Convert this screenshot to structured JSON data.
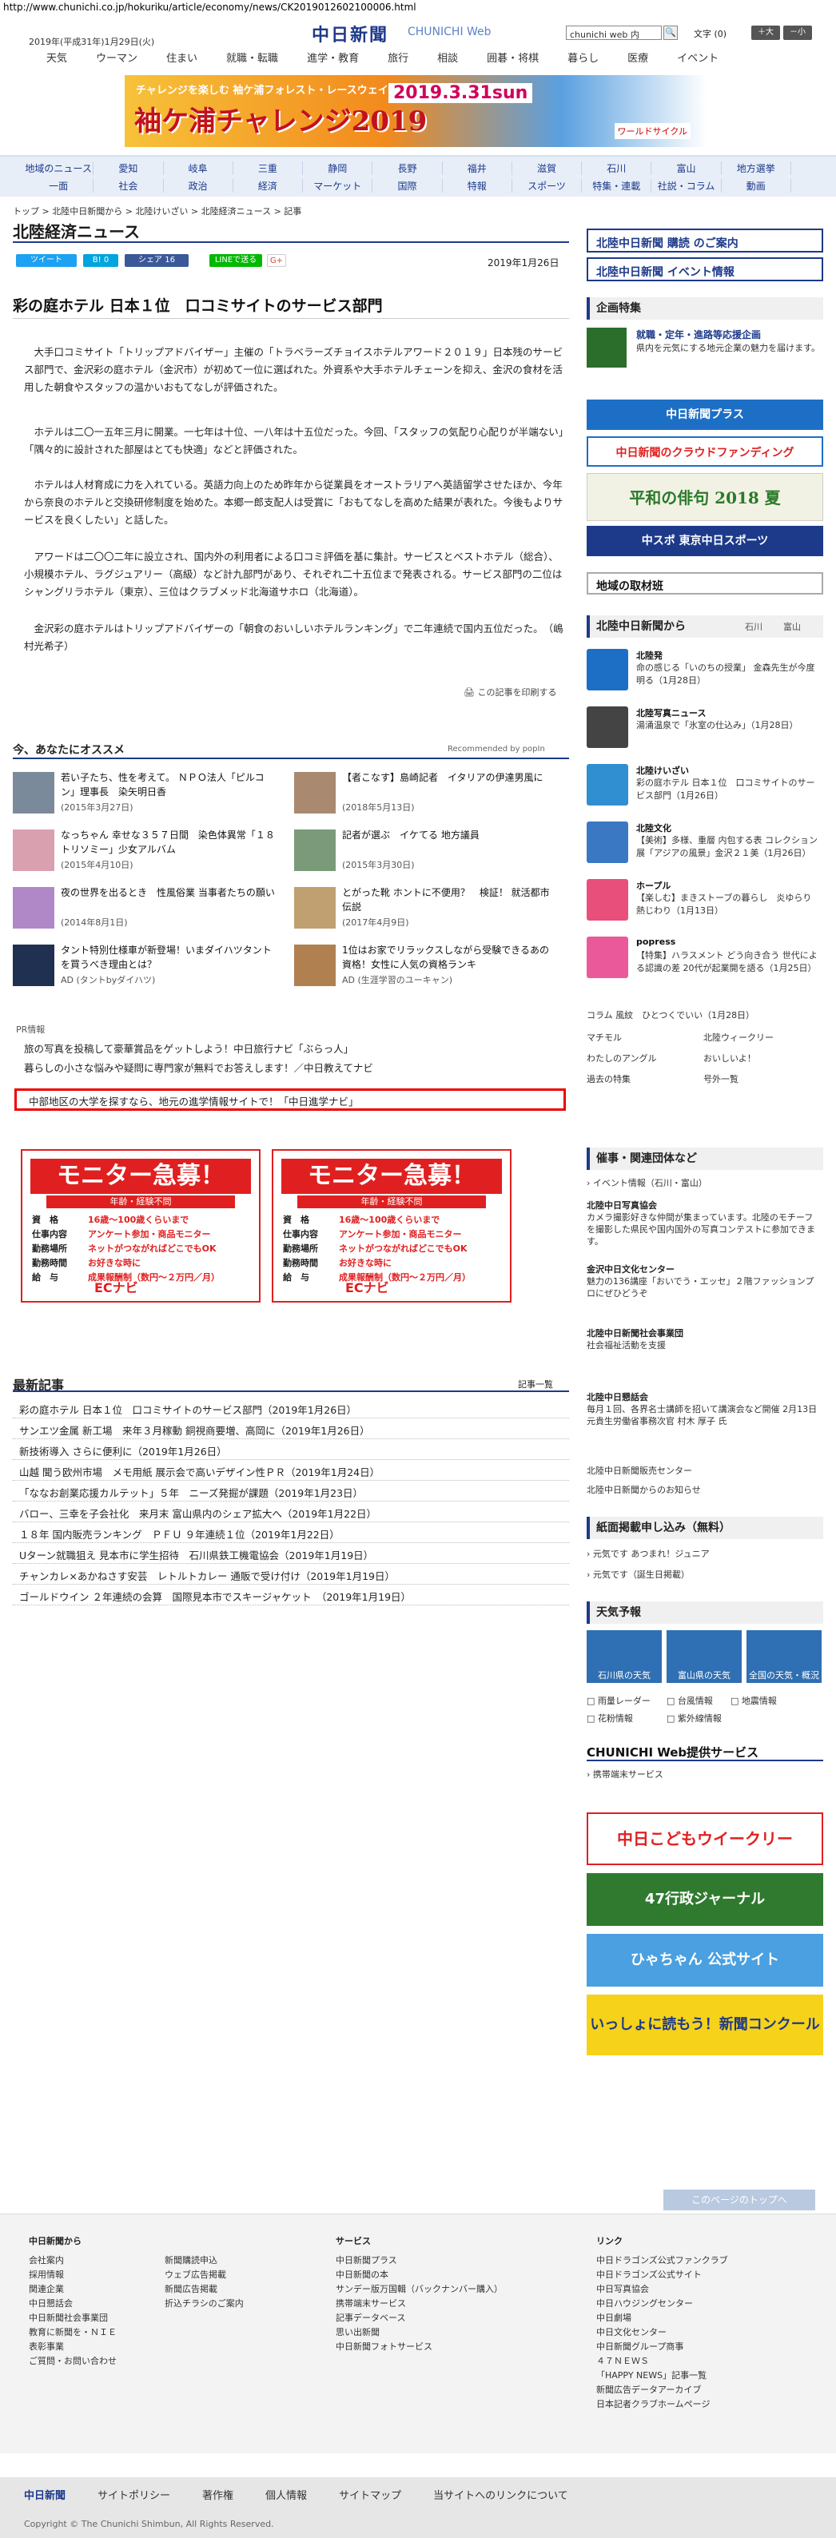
{
  "url": "http://www.chunichi.co.jp/hokuriku/article/economy/news/CK2019012602100006.html",
  "header": {
    "date": "2019年(平成31年)1月29日(火)",
    "logo": "中日新聞",
    "logo_sub": "CHUNICHI Web",
    "search_placeholder": "chunichi web 内",
    "search_button": "🔍",
    "font_label": "文字",
    "font_reset": "(0)",
    "font_up": "＋大",
    "font_down": "－小"
  },
  "top_nav": [
    "天気",
    "ウーマン",
    "住まい",
    "就職・転職",
    "進学・教育",
    "旅行",
    "相談",
    "囲碁・将棋",
    "暮らし",
    "医療",
    "イベント"
  ],
  "ad_banner": {
    "line1": "チャレンジを楽しむ 袖ケ浦フォレスト・レースウェイ",
    "line2": "袖ケ浦チャレンジ2019",
    "line3": "2019.3.31sun",
    "line4": "ワールドサイクル"
  },
  "region_nav_row1": [
    "地域のニュース",
    "愛知",
    "岐阜",
    "三重",
    "静岡",
    "長野",
    "福井",
    "滋賀",
    "石川",
    "富山",
    "地方選挙"
  ],
  "region_nav_row2": [
    "一面",
    "社会",
    "政治",
    "経済",
    "マーケット",
    "国際",
    "特報",
    "スポーツ",
    "特集・連載",
    "社説・コラム",
    "動画"
  ],
  "breadcrumb": "トップ > 北陸中日新聞から > 北陸けいざい > 北陸経済ニュース > 記事",
  "section_title": "北陸経済ニュース",
  "share": {
    "tweet": "ツイート",
    "b": "B! 0",
    "fb": "シェア 16",
    "line": "LINEで送る",
    "g": "G+"
  },
  "pubdate": "2019年1月26日",
  "article": {
    "headline": "彩の庭ホテル 日本１位　口コミサイトのサービス部門",
    "paragraphs": [
      "　大手口コミサイト「トリップアドバイザー」主催の「トラベラーズチョイスホテルアワード２０１９」日本残のサービス部門で、金沢彩の庭ホテル（金沢市）が初めて一位に選ばれた。外資系や大手ホテルチェーンを抑え、金沢の食材を活用した朝食やスタッフの温かいおもてなしが評価された。",
      "　ホテルは二〇一五年三月に開業。一七年は十位、一八年は十五位だった。今回、「スタッフの気配り心配りが半端ない」「隅々的に設計された部屋はとても快適」などと評価された。",
      "　ホテルは人材育成に力を入れている。英語力向上のため昨年から従業員をオーストラリアへ英語留学させたほか、今年から奈良のホテルと交換研修制度を始めた。本郷一郎支配人は受賞に「おもてなしを高めた結果が表れた。今後もよりサービスを良くしたい」と話した。",
      "　アワードは二〇〇二年に設立され、国内外の利用者による口コミ評価を基に集計。サービスとベストホテル（総合）、小規模ホテル、ラグジュアリー（高級）など計九部門があり、それぞれ二十五位まで発表される。サービス部門の二位はシャングリラホテル（東京）、三位はクラブメッド北海道サホロ（北海道）。",
      "　金沢彩の庭ホテルはトリップアドバイザーの「朝食のおいしいホテルランキング」で二年連続で国内五位だった。　（嶋村光希子）"
    ],
    "print": "この記事を印刷する"
  },
  "recommend": {
    "title": "今、あなたにオススメ",
    "powered": "Recommended by popIn",
    "items": [
      {
        "text": "若い子たち、性を考えて。 ＮＰＯ法人「ピルコン」理事長　染矢明日香",
        "date": "(2015年3月27日)"
      },
      {
        "text": "【者こなす】島崎記者　イタリアの伊達男風に",
        "date": "(2018年5月13日)"
      },
      {
        "text": "なっちゃん 幸せな３５７日間　染色体異常「１８トリソミー」少女アルバム",
        "date": "(2015年4月10日)"
      },
      {
        "text": "記者が選ぶ　イケてる 地方議員",
        "date": "(2015年3月30日)"
      },
      {
        "text": "夜の世界を出るとき　性風俗業 当事者たちの願い",
        "date": "(2014年8月1日)"
      },
      {
        "text": "とがった靴 ホントに不便用？　検証！ 就活都市伝説",
        "date": "(2017年4月9日)"
      },
      {
        "text": "タント特別仕様車が新登場！いまダイハツタントを買うべき理由とは？",
        "date": "AD (タントbyダイハツ)"
      },
      {
        "text": "1位はお家でリラックスしながら受験できるあの資格！女性に人気の資格ランキ",
        "date": "AD (生涯学習のユーキャン)"
      }
    ]
  },
  "pr": {
    "label": "PR情報",
    "items": [
      "旅の写真を投稿して豪華賞品をゲットしよう！中日旅行ナビ「ぶらっ人」",
      "暮らしの小さな悩みや疑問に専門家が無料でお答えします！／中日教えてナビ",
      "中部地区の大学を探すなら、地元の進学情報サイトで！「中日進学ナビ」"
    ]
  },
  "monitor": {
    "title": "モニター急募！",
    "sub": "年齢・経験不問",
    "rows": [
      {
        "k": "資　格",
        "v": "16歳～100歳くらいまで"
      },
      {
        "k": "仕事内容",
        "v": "アンケート参加・商品モニター"
      },
      {
        "k": "勤務場所",
        "v": "ネットがつながればどこでもOK"
      },
      {
        "k": "勤務時間",
        "v": "お好きな時に"
      },
      {
        "k": "給　与",
        "v": "成果報酬制（数円～２万円／月）"
      }
    ],
    "logo": "ECナビ"
  },
  "latest": {
    "title": "最新記事",
    "more": "記事一覧",
    "items": [
      "彩の庭ホテル 日本１位　口コミサイトのサービス部門（2019年1月26日）",
      "サンエツ金属 新工場　来年３月稼動 銅視商要増、高岡に（2019年1月26日）",
      "新技術導入 さらに便利に（2019年1月26日）",
      "山越 聞う欧州市場　メモ用紙 展示会で高いデザイン性ＰＲ（2019年1月24日）",
      "「ななお創業応援カルテット」５年　ニーズ発掘が課題（2019年1月23日）",
      "バロー、三幸を子会社化　来月末 富山県内のシェア拡大へ（2019年1月22日）",
      "１８年 国内販売ランキング　ＰＦＵ ９年連続１位（2019年1月22日）",
      "Uターン就職狙え 見本市に学生招待　石川県鉄工機電協会（2019年1月19日）",
      "チャンカレ×あかねさす安芸　レトルトカレー 通販で受け付け（2019年1月19日）",
      "ゴールドウイン ２年連続の会算　国際見本市でスキージャケット　（2019年1月19日）"
    ]
  },
  "side": {
    "subscribe": "北陸中日新聞 購読 のご案内",
    "event": "北陸中日新聞 イベント情報",
    "kikaku_title": "企画特集",
    "kikaku_text": "就職・定年・進路等応援企画",
    "kikaku_sub": "県内を元気にする地元企業の魅力を届けます。",
    "promos": [
      "中日新聞プラス",
      "中日新聞のクラウドファンディング",
      "平和の俳句 2018 夏",
      "中スポ 東京中日スポーツ"
    ],
    "local_info": "地域の取材班",
    "hokuriku_title": "北陸中日新聞から",
    "hokuriku_tabs": [
      "石川",
      "富山"
    ],
    "news": [
      {
        "cat": "北陸発",
        "text": "命の感じる「いのちの授業」 金森先生が今度明る（1月28日）"
      },
      {
        "cat": "北陸写真ニュース",
        "text": "湯涌温泉で「氷室の仕込み」（1月28日）"
      },
      {
        "cat": "北陸けいざい",
        "text": "彩の庭ホテル 日本１位　口コミサイトのサービス部門（1月26日）"
      },
      {
        "cat": "北陸文化",
        "text": "【美術】多様、重層 内包する表 コレクション展「アジアの風景」金沢２１美（1月26日）"
      },
      {
        "cat": "ホープル",
        "text": "【楽しむ】まきストーブの暮らし　炎ゆらり 熱じわり（1月13日）"
      },
      {
        "cat": "popress",
        "text": "【特集】ハラスメント どう向き合う 世代による認識の差 20代が起業開を語る（1月25日）"
      }
    ],
    "links": [
      "コラム 風紋　ひとつくでいい（1月28日）",
      "マチモル",
      "北陸ウィークリー",
      "わたしのアングル",
      "おいしいよ！",
      "過去の特集",
      "号外一覧"
    ],
    "event_title": "催事・関連団体など",
    "event_sub": "イベント情報（石川・富山）",
    "events": [
      {
        "cat": "北陸中日写真協会",
        "text": "カメラ撮影好きな仲間が集まっています。北陸のモチーフを撮影した県民や国内国外の写真コンテストに参加できます。"
      },
      {
        "cat": "金沢中日文化センター",
        "text": "魅力の136講座「おいでう・エッセ」２階ファッションプロにぜひどうぞ"
      },
      {
        "cat": "北陸中日新聞社会事業団",
        "text": "社会福祉活動を支援"
      },
      {
        "cat": "北陸中日懇話会",
        "text": "毎月１回、各界名士講師を招いて講演会など開催 2月13日 元貴生労働省事務次官 村木 厚子 氏"
      }
    ],
    "event_links": [
      "北陸中日新聞販売センター",
      "北陸中日新聞からのお知らせ"
    ],
    "apply_title": "紙面掲載申し込み（無料）",
    "apply": [
      "元気です あつまれ！ジュニア",
      "元気です（誕生日掲載）"
    ],
    "weather_title": "天気予報",
    "weather": [
      "石川県の天気",
      "富山県の天気",
      "全国の天気・概況"
    ],
    "weather_links": [
      "雨量レーダー",
      "台風情報",
      "地震情報",
      "花粉情報",
      "紫外線情報"
    ],
    "service_title": "CHUNICHI Web提供サービス",
    "service_link": "携帯端末サービス",
    "banners": [
      "中日こどもウイークリー",
      "47行政ジャーナル",
      "ひゃちゃん 公式サイト",
      "いっしょに読もう！新聞コンクール"
    ]
  },
  "pagetop": "このページのトップへ",
  "footer": {
    "col1_title": "中日新聞から",
    "col1": [
      "会社案内",
      "採用情報",
      "関連企業",
      "中日懇話会",
      "中日新聞社会事業団",
      "教育に新聞を・ＮＩＥ",
      "表彰事業",
      "ご質問・お問い合わせ"
    ],
    "col2": [
      "新聞購読申込",
      "ウェブ広告掲載",
      "新聞広告掲載",
      "折込チラシのご案内"
    ],
    "col3_title": "サービス",
    "col3": [
      "中日新聞プラス",
      "中日新聞の本",
      "サンデー版万国輯（バックナンバー購入）",
      "携帯端末サービス",
      "記事データベース",
      "思い出新聞",
      "中日新聞フォトサービス"
    ],
    "col4_title": "リンク",
    "col4": [
      "中日ドラゴンズ公式ファンクラブ",
      "中日ドラゴンズ公式サイト",
      "中日写真協会",
      "中日ハウジングセンター",
      "中日劇場",
      "中日文化センター",
      "中日新聞グループ商事",
      "４７ＮＥＷＳ",
      "「HAPPY NEWS」記事一覧",
      "新聞広告データアーカイブ",
      "日本記者クラブホームページ"
    ],
    "bottom_logo": "中日新聞",
    "bottom_nav": [
      "サイトポリシー",
      "著作権",
      "個人情報",
      "サイトマップ",
      "当サイトへのリンクについて"
    ],
    "copyright": "Copyright © The Chunichi Shimbun, All Rights Reserved."
  }
}
